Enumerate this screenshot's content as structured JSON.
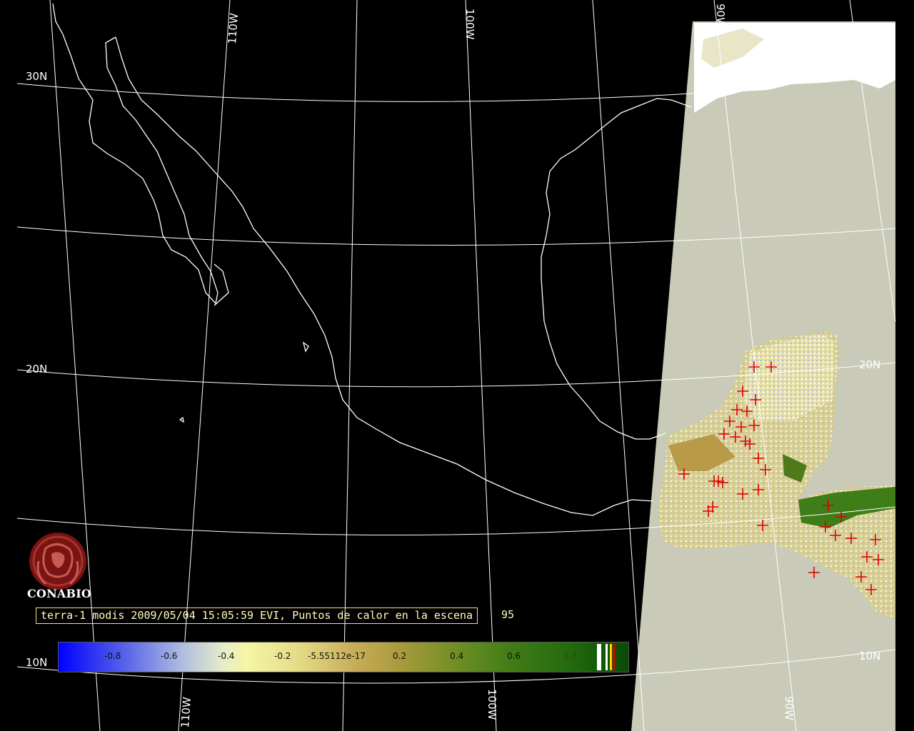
{
  "map": {
    "longitude_labels_top": [
      "110W",
      "100W",
      "90W"
    ],
    "longitude_labels_bottom": [
      "110W",
      "100W",
      "90W"
    ],
    "latitude_labels_left": [
      "30N",
      "20N",
      "10N"
    ],
    "latitude_labels_right": [
      "20N",
      "10N"
    ],
    "colors": {
      "background": "#000000",
      "graticule": "#ffffff",
      "coastline": "#ffffff",
      "cloud_no_data": "#c9cab8",
      "snow_cloud": "#ffffff",
      "hotspot_marker": "#e00000"
    },
    "hotspot_marker": "plus-sign"
  },
  "branding": {
    "logo_text": "CONABIO",
    "logo_icon": "conabio-logo-icon"
  },
  "caption": {
    "text": "terra-1 modis 2009/05/04 15:05:59 EVI, Puntos de calor en la escena",
    "count": "95"
  },
  "legend": {
    "type": "colorbar",
    "ticks": [
      "-0.8",
      "-0.6",
      "-0.4",
      "-0.2",
      "-5.55112e-17",
      "0.2",
      "0.4",
      "0.6",
      "0.8"
    ],
    "range": [
      -1,
      1
    ],
    "colors": {
      "low": "#0000ff",
      "mid": "#f5f6a6",
      "high": "#0c4a05",
      "flag_white": "#ffffff",
      "flag_yellow": "#ffd400",
      "flag_red": "#d40000"
    }
  }
}
